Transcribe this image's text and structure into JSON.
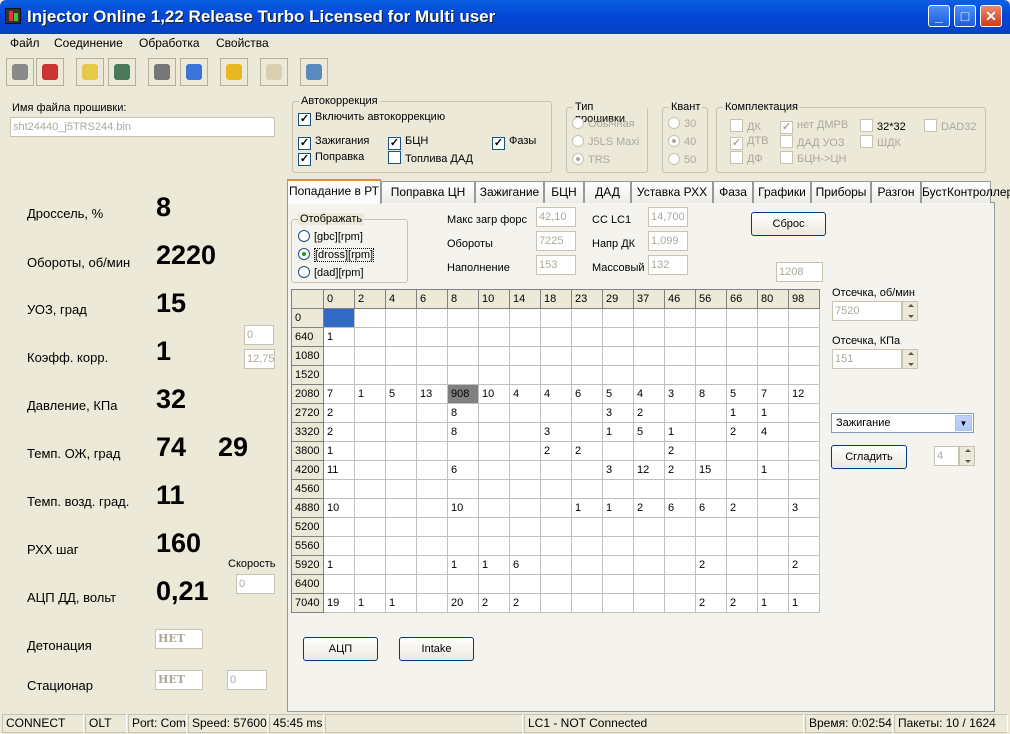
{
  "window": {
    "title": "Injector Online 1,22 Release Turbo  Licensed for Multi user"
  },
  "menu": [
    "Файл",
    "Соединение",
    "Обработка",
    "Свойства"
  ],
  "firmware": {
    "label": "Имя файла прошивки:",
    "file": "sht24440_j5TRS244.bin"
  },
  "autocorr": {
    "title": "Автокоррекция",
    "enable": "Включить автокоррекцию",
    "ign": "Зажигания",
    "bcn": "БЦН",
    "phases": "Фазы",
    "corr": "Поправка",
    "fuel_dad": "Топлива ДАД"
  },
  "fwtype": {
    "title": "Тип прошивки",
    "opts": [
      "Обычная",
      "J5LS Maxi",
      "TRS"
    ]
  },
  "kvant": {
    "title": "Квант",
    "opts": [
      "30",
      "40",
      "50"
    ]
  },
  "komplekt": {
    "title": "Комплектация",
    "dk": "ДК",
    "no_dmrv": "нет ДМРВ",
    "x32": "32*32",
    "dad32": "DAD32",
    "dtv": "ДТВ",
    "dad_uoz": "ДАД УОЗ",
    "shdk": "ШДК",
    "df": "ДФ",
    "bcn_cn": "БЦН->ЦН"
  },
  "gauges": [
    {
      "label": "Дроссель, %",
      "value": "8"
    },
    {
      "label": "Обороты, об/мин",
      "value": "2220"
    },
    {
      "label": "УОЗ, град",
      "value": "15"
    },
    {
      "label": "Коэфф. корр.",
      "value": "1"
    },
    {
      "label": "Давление, КПа",
      "value": "32"
    },
    {
      "label": "Темп. ОЖ, град",
      "value": "74",
      "value2": "29"
    },
    {
      "label": "Темп. возд. град.",
      "value": "11"
    },
    {
      "label": "РХХ шаг",
      "value": "160"
    },
    {
      "label": "АЦП ДД, вольт",
      "value": "0,21"
    }
  ],
  "coef_fields": [
    "0",
    "12,75"
  ],
  "speed": {
    "label": "Скорость",
    "value": "0"
  },
  "detonation": {
    "label": "Детонация",
    "value": "НЕТ"
  },
  "stationary": {
    "label": "Стационар",
    "value": "НЕТ",
    "value2": "0"
  },
  "tabs": [
    "Попадание в РТ",
    "Поправка ЦН",
    "Зажигание",
    "БЦН",
    "ДАД",
    "Уставка РХХ",
    "Фаза",
    "Графики",
    "Приборы",
    "Разгон",
    "БустКонтроллер"
  ],
  "display": {
    "title": "Отображать",
    "opts": [
      "[gbc][rpm]",
      "[dross][rpm]",
      "[dad][rpm]"
    ]
  },
  "info": {
    "max_load_lbl": "Макс загр форс",
    "max_load": "42,10",
    "rpm_lbl": "Обороты",
    "rpm": "7225",
    "fill_lbl": "Наполнение",
    "fill": "153",
    "cc_lbl": "CC LC1",
    "cc": "14,700",
    "dk_lbl": "Напр ДК",
    "dk": "1,099",
    "mass_lbl": "Массовый",
    "mass": "132",
    "reset": "Сброс",
    "extra": "1208"
  },
  "grid": {
    "cols": [
      "0",
      "2",
      "4",
      "6",
      "8",
      "10",
      "14",
      "18",
      "23",
      "29",
      "37",
      "46",
      "56",
      "66",
      "80",
      "98"
    ],
    "rows": [
      {
        "h": "0",
        "c": [
          "",
          "",
          "",
          "",
          "",
          "",
          "",
          "",
          "",
          "",
          "",
          "",
          "",
          "",
          "",
          ""
        ]
      },
      {
        "h": "640",
        "c": [
          "1",
          "",
          "",
          "",
          "",
          "",
          "",
          "",
          "",
          "",
          "",
          "",
          "",
          "",
          "",
          ""
        ]
      },
      {
        "h": "1080",
        "c": [
          "",
          "",
          "",
          "",
          "",
          "",
          "",
          "",
          "",
          "",
          "",
          "",
          "",
          "",
          "",
          ""
        ]
      },
      {
        "h": "1520",
        "c": [
          "",
          "",
          "",
          "",
          "",
          "",
          "",
          "",
          "",
          "",
          "",
          "",
          "",
          "",
          "",
          ""
        ]
      },
      {
        "h": "2080",
        "c": [
          "7",
          "1",
          "5",
          "13",
          "908",
          "10",
          "4",
          "4",
          "6",
          "5",
          "4",
          "3",
          "8",
          "5",
          "7",
          "12"
        ]
      },
      {
        "h": "2720",
        "c": [
          "2",
          "",
          "",
          "",
          "8",
          "",
          "",
          "",
          "",
          "3",
          "2",
          "",
          "",
          "1",
          "1",
          ""
        ]
      },
      {
        "h": "3320",
        "c": [
          "2",
          "",
          "",
          "",
          "8",
          "",
          "",
          "3",
          "",
          "1",
          "5",
          "1",
          "",
          "2",
          "4",
          ""
        ]
      },
      {
        "h": "3800",
        "c": [
          "1",
          "",
          "",
          "",
          "",
          "",
          "",
          "2",
          "2",
          "",
          "",
          "2",
          "",
          "",
          "",
          ""
        ]
      },
      {
        "h": "4200",
        "c": [
          "11",
          "",
          "",
          "",
          "6",
          "",
          "",
          "",
          "",
          "3",
          "12",
          "2",
          "15",
          "",
          "1",
          ""
        ]
      },
      {
        "h": "4560",
        "c": [
          "",
          "",
          "",
          "",
          "",
          "",
          "",
          "",
          "",
          "",
          "",
          "",
          "",
          "",
          "",
          ""
        ]
      },
      {
        "h": "4880",
        "c": [
          "10",
          "",
          "",
          "",
          "10",
          "",
          "",
          "",
          "1",
          "1",
          "2",
          "6",
          "6",
          "2",
          "",
          "3"
        ]
      },
      {
        "h": "5200",
        "c": [
          "",
          "",
          "",
          "",
          "",
          "",
          "",
          "",
          "",
          "",
          "",
          "",
          "",
          "",
          "",
          ""
        ]
      },
      {
        "h": "5560",
        "c": [
          "",
          "",
          "",
          "",
          "",
          "",
          "",
          "",
          "",
          "",
          "",
          "",
          "",
          "",
          "",
          ""
        ]
      },
      {
        "h": "5920",
        "c": [
          "1",
          "",
          "",
          "",
          "1",
          "1",
          "6",
          "",
          "",
          "",
          "",
          "",
          "2",
          "",
          "",
          "2"
        ]
      },
      {
        "h": "6400",
        "c": [
          "",
          "",
          "",
          "",
          "",
          "",
          "",
          "",
          "",
          "",
          "",
          "",
          "",
          "",
          "",
          ""
        ]
      },
      {
        "h": "7040",
        "c": [
          "19",
          "1",
          "1",
          "",
          "20",
          "2",
          "2",
          "",
          "",
          "",
          "",
          "",
          "2",
          "2",
          "1",
          "1"
        ]
      }
    ]
  },
  "cutoff_rpm": {
    "label": "Отсечка, об/мин",
    "value": "7520"
  },
  "cutoff_kpa": {
    "label": "Отсечка, КПа",
    "value": "151"
  },
  "map_select": "Зажигание",
  "smooth": {
    "label": "Сгладить",
    "value": "4"
  },
  "buttons": {
    "adc": "АЦП",
    "intake": "Intake"
  },
  "status": [
    "CONNECT",
    "OLT",
    "Port: Com",
    "Speed: 57600",
    "45:45 ms",
    "",
    "LC1 - NOT Connected",
    "Время: 0:02:54",
    "Пакеты: 10 / 1624"
  ]
}
